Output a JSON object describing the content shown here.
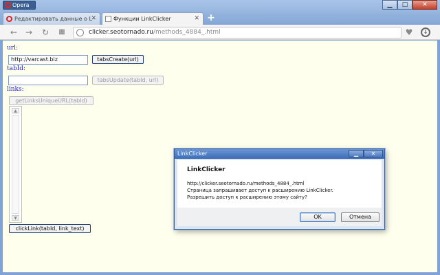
{
  "browser": {
    "menu_label": "Opera",
    "window_controls": [
      "minimize-icon",
      "maximize-icon",
      "close-icon"
    ],
    "tabs": [
      {
        "title": "Редактировать данные о L",
        "icon": "opera-icon",
        "active": false
      },
      {
        "title": "Функции LinkClicker",
        "icon": "document-icon",
        "active": true
      }
    ],
    "new_tab_label": "+",
    "address": {
      "domain": "clicker.seotornado.ru",
      "path": "/methods_4884_.html"
    }
  },
  "page": {
    "url_label": "url:",
    "url_value": "http://varcast.biz",
    "tabs_create_label": "tabsCreate(url)",
    "tabid_label": "tabId:",
    "tabid_value": "",
    "tabs_update_label": "tabsUpdate(tabId, url)",
    "links_label": "links:",
    "get_links_label": "getLinksUniqueURL(tabId)",
    "click_link_label": "clickLink(tabId, link_text)"
  },
  "dialog": {
    "title": "LinkClicker",
    "heading": "LinkClicker",
    "lines": [
      "http://clicker.seotornado.ru/methods_4884_.html",
      "Страница запрашивает доступ к расширению LinkClicker.",
      "Разрешить доступ к расширению этому сайту?"
    ],
    "ok_label": "OK",
    "cancel_label": "Отмена"
  },
  "colors": {
    "page_bg": "#ffffee",
    "label_blue": "#1b1bd6",
    "frame_blue": "#7fa3d4"
  }
}
